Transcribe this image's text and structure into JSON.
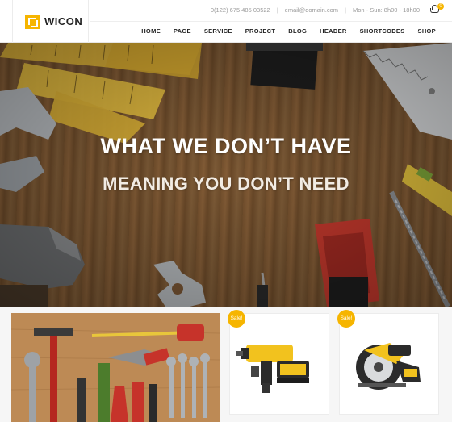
{
  "brand": {
    "name": "WICON"
  },
  "topbar": {
    "phone": "0(122) 675 485 03522",
    "email": "email@domain.com",
    "hours": "Mon - Sun: 8h00 - 18h00",
    "separator": "|",
    "cart_count": "0"
  },
  "nav": {
    "items": [
      "HOME",
      "PAGE",
      "SERVICE",
      "PROJECT",
      "BLOG",
      "HEADER",
      "SHORTCODES",
      "SHOP"
    ]
  },
  "hero": {
    "title": "WHAT WE DON’T HAVE",
    "subtitle": "MEANING YOU DON’T NEED"
  },
  "products": {
    "cards": [
      {
        "badge": "Sale!",
        "icon": "rotary-hammer-drill-icon"
      },
      {
        "badge": "Sale!",
        "icon": "circular-saw-icon"
      }
    ]
  },
  "colors": {
    "accent": "#f6b500",
    "text": "#222222"
  }
}
